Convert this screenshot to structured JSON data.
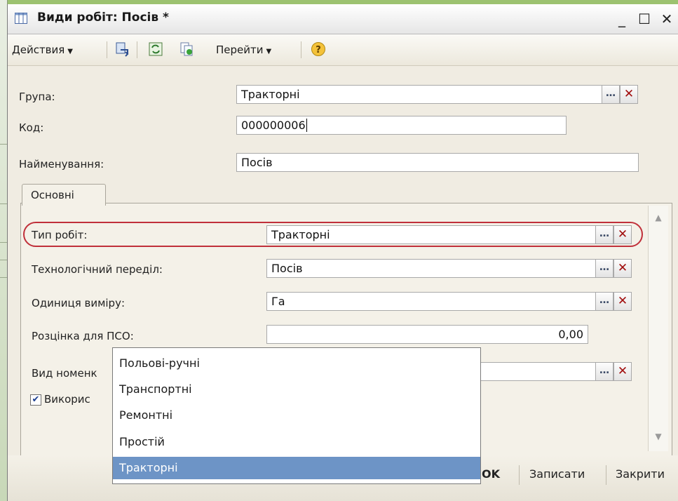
{
  "window": {
    "title": "Види робіт: Посів *",
    "minimize": "_",
    "maximize": "☐",
    "close": "✕"
  },
  "toolbar": {
    "actions_label": "Действия",
    "goto_label": "Перейти",
    "help_label": "?"
  },
  "header_fields": {
    "group_label": "Група:",
    "group_value": "Тракторні",
    "code_label": "Код:",
    "code_value": "000000006",
    "name_label": "Найменування:",
    "name_value": "Посів"
  },
  "tabs": [
    {
      "label": "Основні"
    }
  ],
  "main_fields": {
    "work_type_label": "Тип робіт:",
    "work_type_value": "Тракторні",
    "tech_stage_label": "Технологічний переділ:",
    "tech_stage_value": "Посів",
    "unit_label": "Одиниця виміру:",
    "unit_value": "Га",
    "price_label": "Розцінка для ПСО:",
    "price_value": "0,00",
    "nomenclature_label_visible": "Вид номенк",
    "use_label_visible": "Викорис"
  },
  "dropdown": {
    "options": [
      "Польові-ручні",
      "Транспортні",
      "Ремонтні",
      "Простій",
      "Тракторні"
    ],
    "selected": "Тракторні"
  },
  "buttons": {
    "ok": "OK",
    "save": "Записати",
    "close": "Закрити"
  },
  "icons": {
    "select": "…",
    "clear": "✕",
    "scroll_up": "▲",
    "scroll_down": "▼",
    "check": "✔"
  },
  "colors": {
    "highlight": "#c0303a",
    "selection": "#6d94c6",
    "clear_button": "#a10d0d"
  }
}
